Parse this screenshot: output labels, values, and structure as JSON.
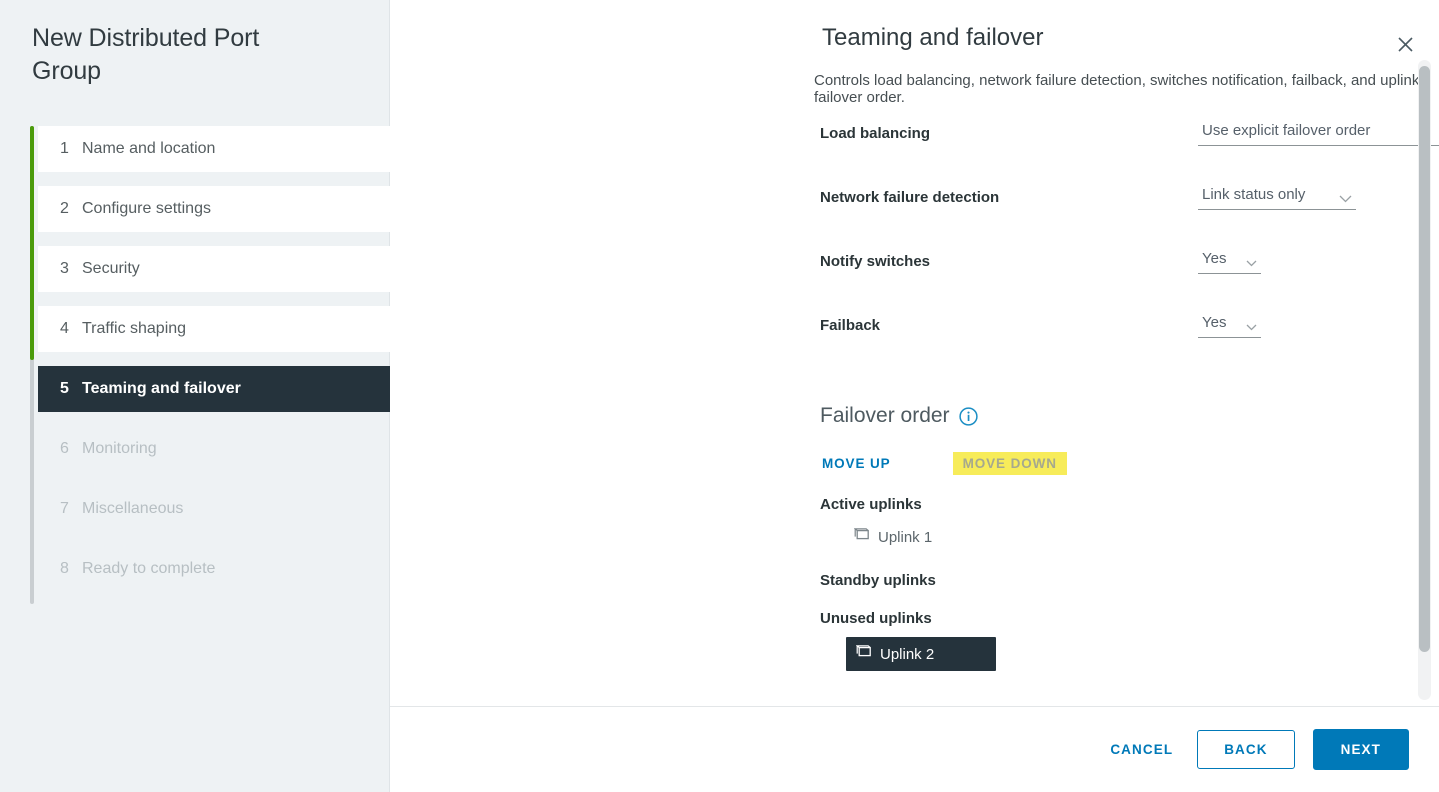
{
  "wizard": {
    "title": "New Distributed Port Group",
    "steps": [
      {
        "num": "1",
        "label": "Name and location",
        "state": "complete"
      },
      {
        "num": "2",
        "label": "Configure settings",
        "state": "complete"
      },
      {
        "num": "3",
        "label": "Security",
        "state": "complete"
      },
      {
        "num": "4",
        "label": "Traffic shaping",
        "state": "complete"
      },
      {
        "num": "5",
        "label": "Teaming and failover",
        "state": "active"
      },
      {
        "num": "6",
        "label": "Monitoring",
        "state": "disabled"
      },
      {
        "num": "7",
        "label": "Miscellaneous",
        "state": "disabled"
      },
      {
        "num": "8",
        "label": "Ready to complete",
        "state": "disabled"
      }
    ]
  },
  "pane": {
    "title": "Teaming and failover",
    "subtitle": "Controls load balancing, network failure detection, switches notification, failback, and uplink failover order.",
    "close_icon": "close-icon"
  },
  "form": {
    "load_balancing": {
      "label": "Load balancing",
      "value": "Use explicit failover order"
    },
    "network_failure_detection": {
      "label": "Network failure detection",
      "value": "Link status only"
    },
    "notify_switches": {
      "label": "Notify switches",
      "value": "Yes"
    },
    "failback": {
      "label": "Failback",
      "value": "Yes"
    }
  },
  "failover_order": {
    "heading": "Failover order",
    "info_icon": "info-icon",
    "move_up_label": "MOVE UP",
    "move_down_label": "MOVE DOWN",
    "groups": [
      {
        "title": "Active uplinks",
        "uplinks": [
          {
            "name": "Uplink 1",
            "selected": false
          }
        ]
      },
      {
        "title": "Standby uplinks",
        "uplinks": []
      },
      {
        "title": "Unused uplinks",
        "uplinks": [
          {
            "name": "Uplink 2",
            "selected": true
          }
        ]
      }
    ]
  },
  "footer": {
    "cancel_label": "CANCEL",
    "back_label": "BACK",
    "next_label": "NEXT"
  },
  "colors": {
    "accent_blue": "#0079b8",
    "progress_green": "#4b9b0b",
    "selected_dark": "#25333c",
    "highlight_yellow": "#f7ec5a"
  }
}
